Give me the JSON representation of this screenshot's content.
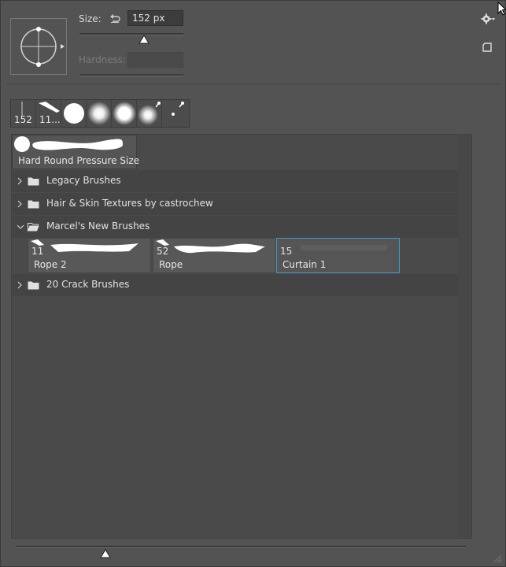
{
  "controls": {
    "size_label": "Size:",
    "size_value": "152 px",
    "hardness_label": "Hardness:",
    "hardness_value": ""
  },
  "recent_brushes": [
    {
      "size": "152",
      "kind": "flat-tip"
    },
    {
      "size": "11...",
      "kind": "feather-tip"
    },
    {
      "size": "",
      "kind": "hard-round"
    },
    {
      "size": "",
      "kind": "soft-round"
    },
    {
      "size": "",
      "kind": "soft-round"
    },
    {
      "size": "",
      "kind": "soft-round-pressure"
    },
    {
      "size": "",
      "kind": "small-round-pressure"
    }
  ],
  "current_brush": {
    "label": "Hard Round Pressure Size"
  },
  "groups": [
    {
      "name": "Legacy Brushes",
      "expanded": false
    },
    {
      "name": "Hair & Skin Textures by castrochew",
      "expanded": false
    },
    {
      "name": "Marcel's New Brushes",
      "expanded": true,
      "brushes": [
        {
          "size": "11",
          "name": "Rope 2",
          "selected": false
        },
        {
          "size": "52",
          "name": "Rope",
          "selected": false
        },
        {
          "size": "15",
          "name": "Curtain 1",
          "selected": true
        }
      ]
    },
    {
      "name": "20 Crack Brushes",
      "expanded": false
    }
  ],
  "colors": {
    "panel_bg": "#535353",
    "selection": "#3e9bd0",
    "group_bg": "#444444"
  }
}
